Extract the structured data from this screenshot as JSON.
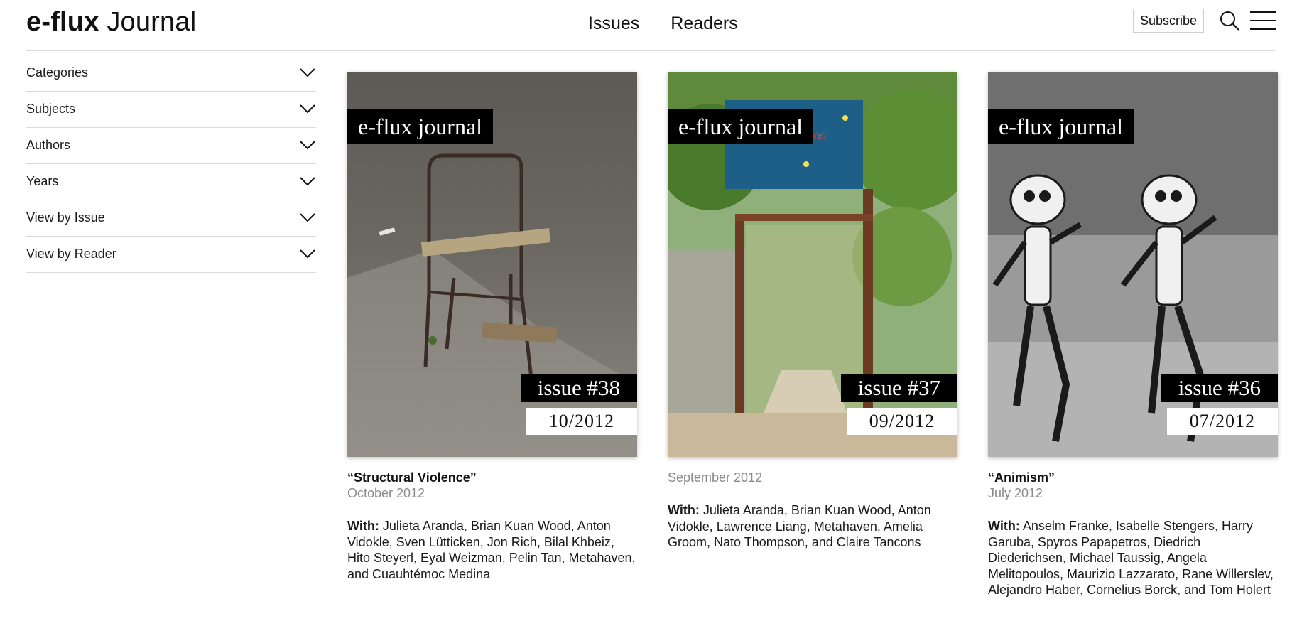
{
  "header": {
    "brand": "e-flux",
    "product": "Journal",
    "nav": [
      "Issues",
      "Readers"
    ],
    "subscribe_label": "Subscribe"
  },
  "sidebar": {
    "filters": [
      "Categories",
      "Subjects",
      "Authors",
      "Years",
      "View by Issue",
      "View by Reader"
    ]
  },
  "issues": [
    {
      "journal_label": "e-flux journal",
      "issue_label": "issue #38",
      "date_label": "10/2012",
      "title": "“Structural Violence”",
      "date": "October 2012",
      "with_label": "With:",
      "contributors": "Julieta Aranda, Brian Kuan Wood, Anton Vidokle, Sven Lütticken, Jon Rich, Bilal Khbeiz, Hito Steyerl, Eyal Weizman, Pelin Tan, Metahaven, and Cuauhtémoc Medina",
      "cover_image": "photo of a broken metal chair with a wooden plank on concrete ground"
    },
    {
      "journal_label": "e-flux journal",
      "issue_label": "issue #37",
      "date_label": "09/2012",
      "title": "",
      "date": "September 2012",
      "with_label": "With:",
      "contributors": "Julieta Aranda, Brian Kuan Wood, Anton Vidokle, Lawrence Liang, Metahaven, Amelia Groom, Nato Thompson, and Claire Tancons",
      "cover_image": "photo of a wooden gate under a blue kindergarten sign surrounded by tropical plants"
    },
    {
      "journal_label": "e-flux journal",
      "issue_label": "issue #36",
      "date_label": "07/2012",
      "title": "“Animism”",
      "date": "July 2012",
      "with_label": "With:",
      "contributors": "Anselm Franke, Isabelle Stengers, Harry Garuba, Spyros Papapetros, Diedrich Diederichsen, Michael Taussig, Angela Melitopoulos, Maurizio Lazzarato, Rane Willerslev, Alejandro Haber, Cornelius Borck, and Tom Holert",
      "cover_image": "black and white cartoon still of dancing skeletons"
    }
  ],
  "colors": {
    "text": "#111111",
    "muted": "#8a8a8a",
    "rule": "#dcdcdc",
    "label_bg": "#000000"
  },
  "icons": [
    "search-icon",
    "hamburger-menu-icon",
    "chevron-down-icon"
  ]
}
